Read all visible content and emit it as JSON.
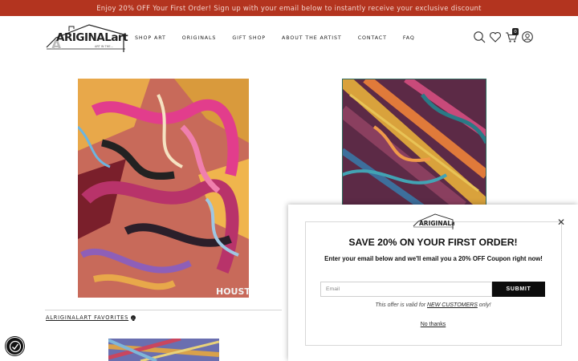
{
  "announcement": {
    "text": "Enjoy 20% OFF Your First Order! Sign up with your email below to instantly receive your exclusive discount",
    "bg": "#b3341f",
    "color": "#f4d6cf"
  },
  "header": {
    "logo_text": "ARIGINALart",
    "logo_sub": "ART IN THE...",
    "nav": [
      "SHOP ART",
      "ORIGINALS",
      "GIFT SHOP",
      "ABOUT THE ARTIST",
      "CONTACT",
      "FAQ"
    ],
    "icons": [
      "search-icon",
      "heart-icon",
      "cart-icon",
      "account-icon"
    ],
    "cart_count": "0"
  },
  "main": {
    "signature": "HOUST",
    "favorites_label": "ALRIGINALART FAVORITES"
  },
  "popup": {
    "title": "SAVE 20% ON YOUR FIRST ORDER!",
    "subtitle": "Enter your email below and we'll email you a 20% OFF Coupon right now!",
    "email_placeholder": "Email",
    "submit_label": "SUBMIT",
    "offer_prefix": "This offer is valid for ",
    "offer_link": "NEW CUSTOMERS",
    "offer_suffix": " only!",
    "no_thanks": "No thanks"
  }
}
